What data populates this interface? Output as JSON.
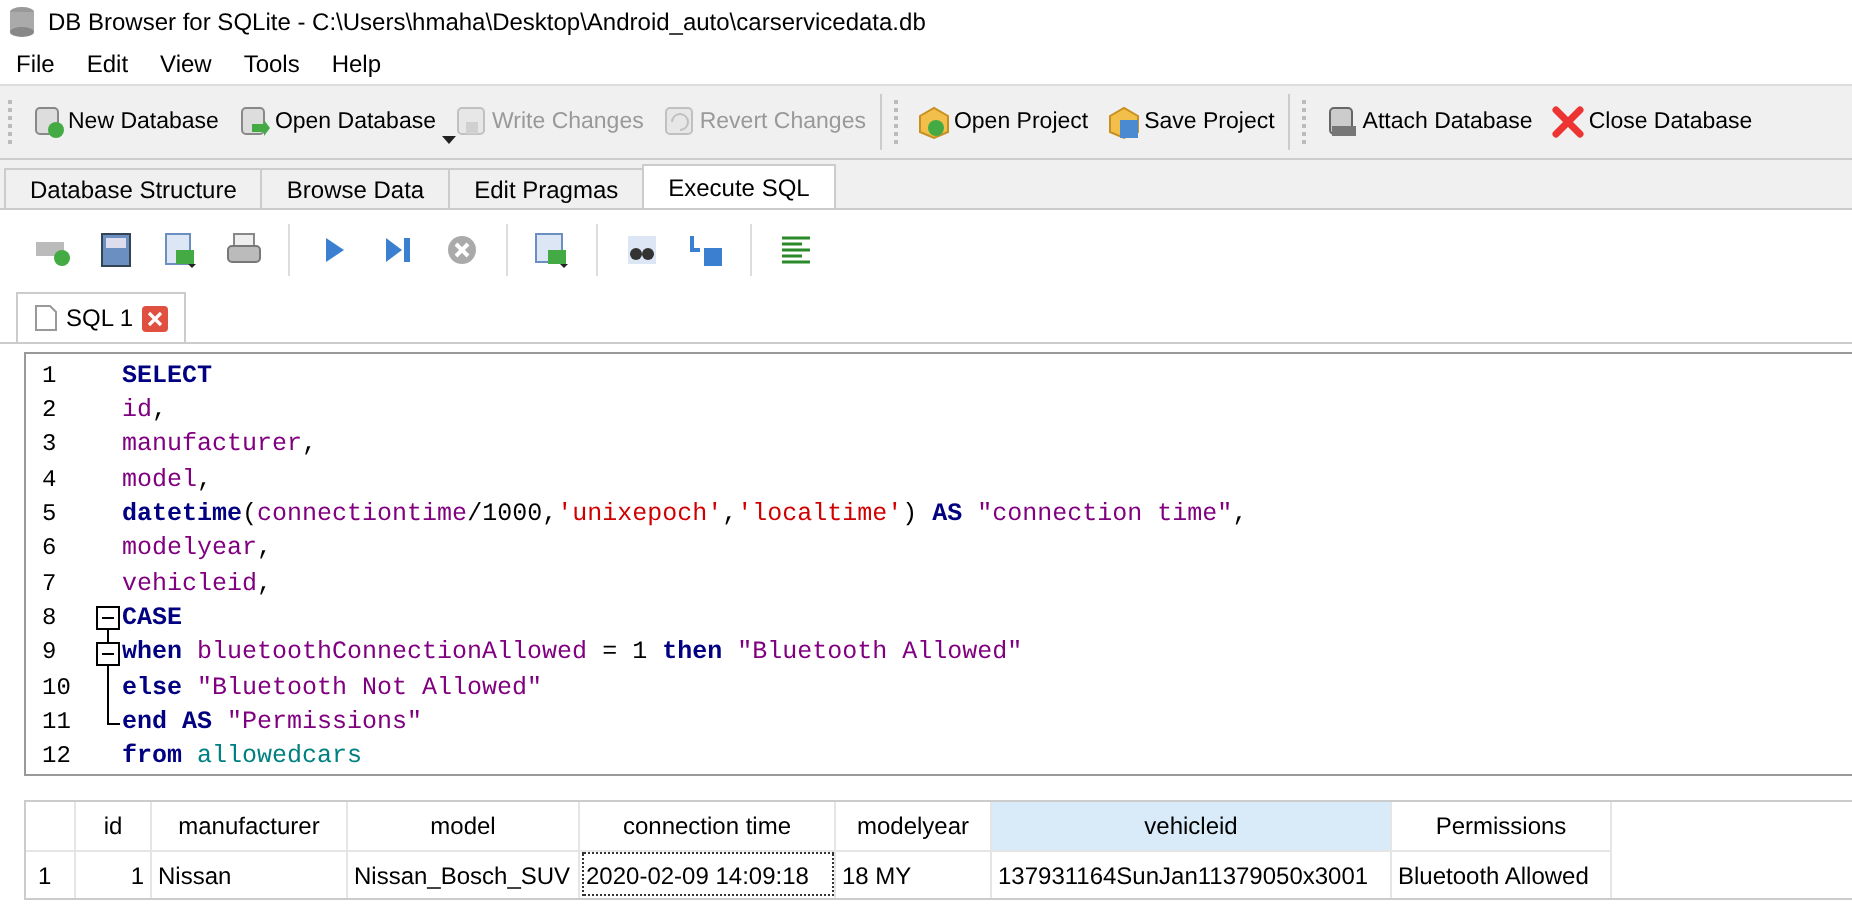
{
  "window": {
    "title": "DB Browser for SQLite - C:\\Users\\hmaha\\Desktop\\Android_auto\\carservicedata.db"
  },
  "menu": [
    "File",
    "Edit",
    "View",
    "Tools",
    "Help"
  ],
  "toolbar": [
    {
      "label": "New Database",
      "disabled": false,
      "dropdown": false
    },
    {
      "label": "Open Database",
      "disabled": false,
      "dropdown": true
    },
    {
      "label": "Write Changes",
      "disabled": true,
      "dropdown": false
    },
    {
      "label": "Revert Changes",
      "disabled": true,
      "dropdown": false
    },
    {
      "label": "Open Project",
      "disabled": false,
      "dropdown": false
    },
    {
      "label": "Save Project",
      "disabled": false,
      "dropdown": false
    },
    {
      "label": "Attach Database",
      "disabled": false,
      "dropdown": false
    },
    {
      "label": "Close Database",
      "disabled": false,
      "dropdown": false
    }
  ],
  "tabs": [
    {
      "label": "Database Structure",
      "selected": false
    },
    {
      "label": "Browse Data",
      "selected": false
    },
    {
      "label": "Edit Pragmas",
      "selected": false
    },
    {
      "label": "Execute SQL",
      "selected": true
    }
  ],
  "editor_tab": {
    "label": "SQL 1"
  },
  "sql_lines": [
    {
      "number": "1",
      "tokens": [
        {
          "kind": "keyword",
          "text": "SELECT"
        }
      ]
    },
    {
      "number": "2",
      "tokens": [
        {
          "kind": "field",
          "text": "id"
        },
        {
          "kind": "punct",
          "text": ","
        }
      ]
    },
    {
      "number": "3",
      "tokens": [
        {
          "kind": "field",
          "text": "manufacturer"
        },
        {
          "kind": "punct",
          "text": ","
        }
      ]
    },
    {
      "number": "4",
      "tokens": [
        {
          "kind": "field",
          "text": "model"
        },
        {
          "kind": "punct",
          "text": ","
        }
      ]
    },
    {
      "number": "5",
      "tokens": [
        {
          "kind": "keyword",
          "text": "datetime"
        },
        {
          "kind": "punct",
          "text": "("
        },
        {
          "kind": "field",
          "text": "connectiontime"
        },
        {
          "kind": "punct",
          "text": "/1000,"
        },
        {
          "kind": "sstring",
          "text": "'unixepoch'"
        },
        {
          "kind": "punct",
          "text": ","
        },
        {
          "kind": "sstring",
          "text": "'localtime'"
        },
        {
          "kind": "punct",
          "text": ")"
        },
        {
          "kind": "keyword",
          "text": " AS"
        },
        {
          "kind": "dstring",
          "text": " \"connection time\""
        },
        {
          "kind": "punct",
          "text": ","
        }
      ]
    },
    {
      "number": "6",
      "tokens": [
        {
          "kind": "field",
          "text": "modelyear"
        },
        {
          "kind": "punct",
          "text": ","
        }
      ]
    },
    {
      "number": "7",
      "tokens": [
        {
          "kind": "field",
          "text": "vehicleid"
        },
        {
          "kind": "punct",
          "text": ","
        }
      ]
    },
    {
      "number": "8",
      "kind": "foldstart",
      "tokens": [
        {
          "kind": "keyword",
          "text": "CASE"
        }
      ]
    },
    {
      "number": "9",
      "kind": "foldstart",
      "tokens": [
        {
          "kind": "keyword",
          "text": "when"
        },
        {
          "kind": "field",
          "text": " bluetoothConnectionAllowed"
        },
        {
          "kind": "punct",
          "text": " = 1"
        },
        {
          "kind": "keyword",
          "text": " then"
        },
        {
          "kind": "dstring",
          "text": " \"Bluetooth Allowed\""
        }
      ]
    },
    {
      "number": "10",
      "kind": "foldline",
      "tokens": [
        {
          "kind": "keyword",
          "text": "else"
        },
        {
          "kind": "dstring",
          "text": " \"Bluetooth Not Allowed\""
        }
      ]
    },
    {
      "number": "11",
      "kind": "foldend",
      "tokens": [
        {
          "kind": "keyword",
          "text": "end AS"
        },
        {
          "kind": "dstring",
          "text": " \"Permissions\""
        }
      ]
    },
    {
      "number": "12",
      "tokens": [
        {
          "kind": "keyword",
          "text": "from"
        },
        {
          "kind": "table",
          "text": " allowedcars"
        }
      ]
    }
  ],
  "results": {
    "columns": [
      {
        "label": "id",
        "selected": false
      },
      {
        "label": "manufacturer",
        "selected": false
      },
      {
        "label": "model",
        "selected": false
      },
      {
        "label": "connection time",
        "selected": false
      },
      {
        "label": "modelyear",
        "selected": false
      },
      {
        "label": "vehicleid",
        "selected": true
      },
      {
        "label": "Permissions",
        "selected": false
      }
    ],
    "rows": [
      {
        "number": "1",
        "cells": [
          {
            "text": "1",
            "focused": false
          },
          {
            "text": "Nissan",
            "focused": false
          },
          {
            "text": "Nissan_Bosch_SUV",
            "focused": false
          },
          {
            "text": "2020-02-09 14:09:18",
            "focused": true
          },
          {
            "text": "18 MY",
            "focused": false
          },
          {
            "text": "137931164SunJan11379050x3001",
            "focused": false
          },
          {
            "text": "Bluetooth Allowed",
            "focused": false
          }
        ]
      }
    ]
  }
}
